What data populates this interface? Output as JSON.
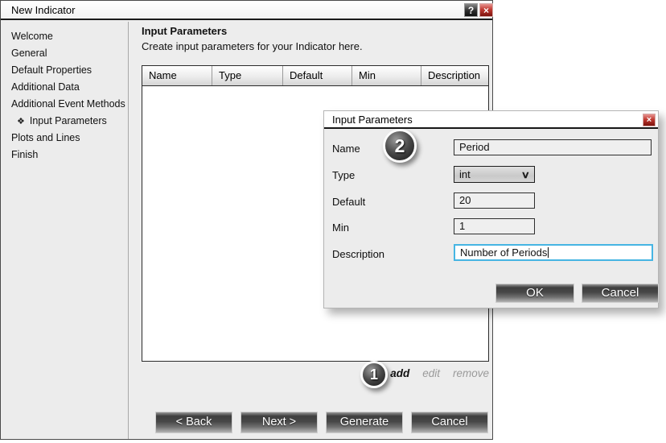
{
  "window": {
    "title": "New Indicator",
    "help_glyph": "?",
    "close_glyph": "×"
  },
  "sidebar": {
    "selected_icon": "❖",
    "items": [
      {
        "label": "Welcome",
        "selected": false
      },
      {
        "label": "General",
        "selected": false
      },
      {
        "label": "Default Properties",
        "selected": false
      },
      {
        "label": "Additional Data",
        "selected": false
      },
      {
        "label": "Additional Event Methods",
        "selected": false
      },
      {
        "label": "Input Parameters",
        "selected": true
      },
      {
        "label": "Plots and Lines",
        "selected": false
      },
      {
        "label": "Finish",
        "selected": false
      }
    ]
  },
  "main": {
    "heading": "Input Parameters",
    "subtitle": "Create input parameters for your Indicator here.",
    "table": {
      "columns": [
        "Name",
        "Type",
        "Default",
        "Min",
        "Description"
      ],
      "rows": []
    },
    "actions": {
      "add": "add",
      "edit": "edit",
      "remove": "remove"
    },
    "nav_buttons": [
      "< Back",
      "Next >",
      "Generate",
      "Cancel"
    ]
  },
  "dialog": {
    "title": "Input Parameters",
    "close_glyph": "×",
    "name": {
      "label": "Name",
      "value": "Period"
    },
    "type": {
      "label": "Type",
      "value": "int",
      "chevron": "∨"
    },
    "default": {
      "label": "Default",
      "value": "20"
    },
    "min": {
      "label": "Min",
      "value": "1"
    },
    "description": {
      "label": "Description",
      "value": "Number of Periods"
    },
    "ok_label": "OK",
    "cancel_label": "Cancel"
  },
  "callouts": {
    "step1": "1",
    "step2": "2"
  },
  "colors": {
    "focus_border": "#46b5e3",
    "close_button_red": "#b03028",
    "window_bg": "#ededed",
    "button_face_dark": "#474747"
  }
}
